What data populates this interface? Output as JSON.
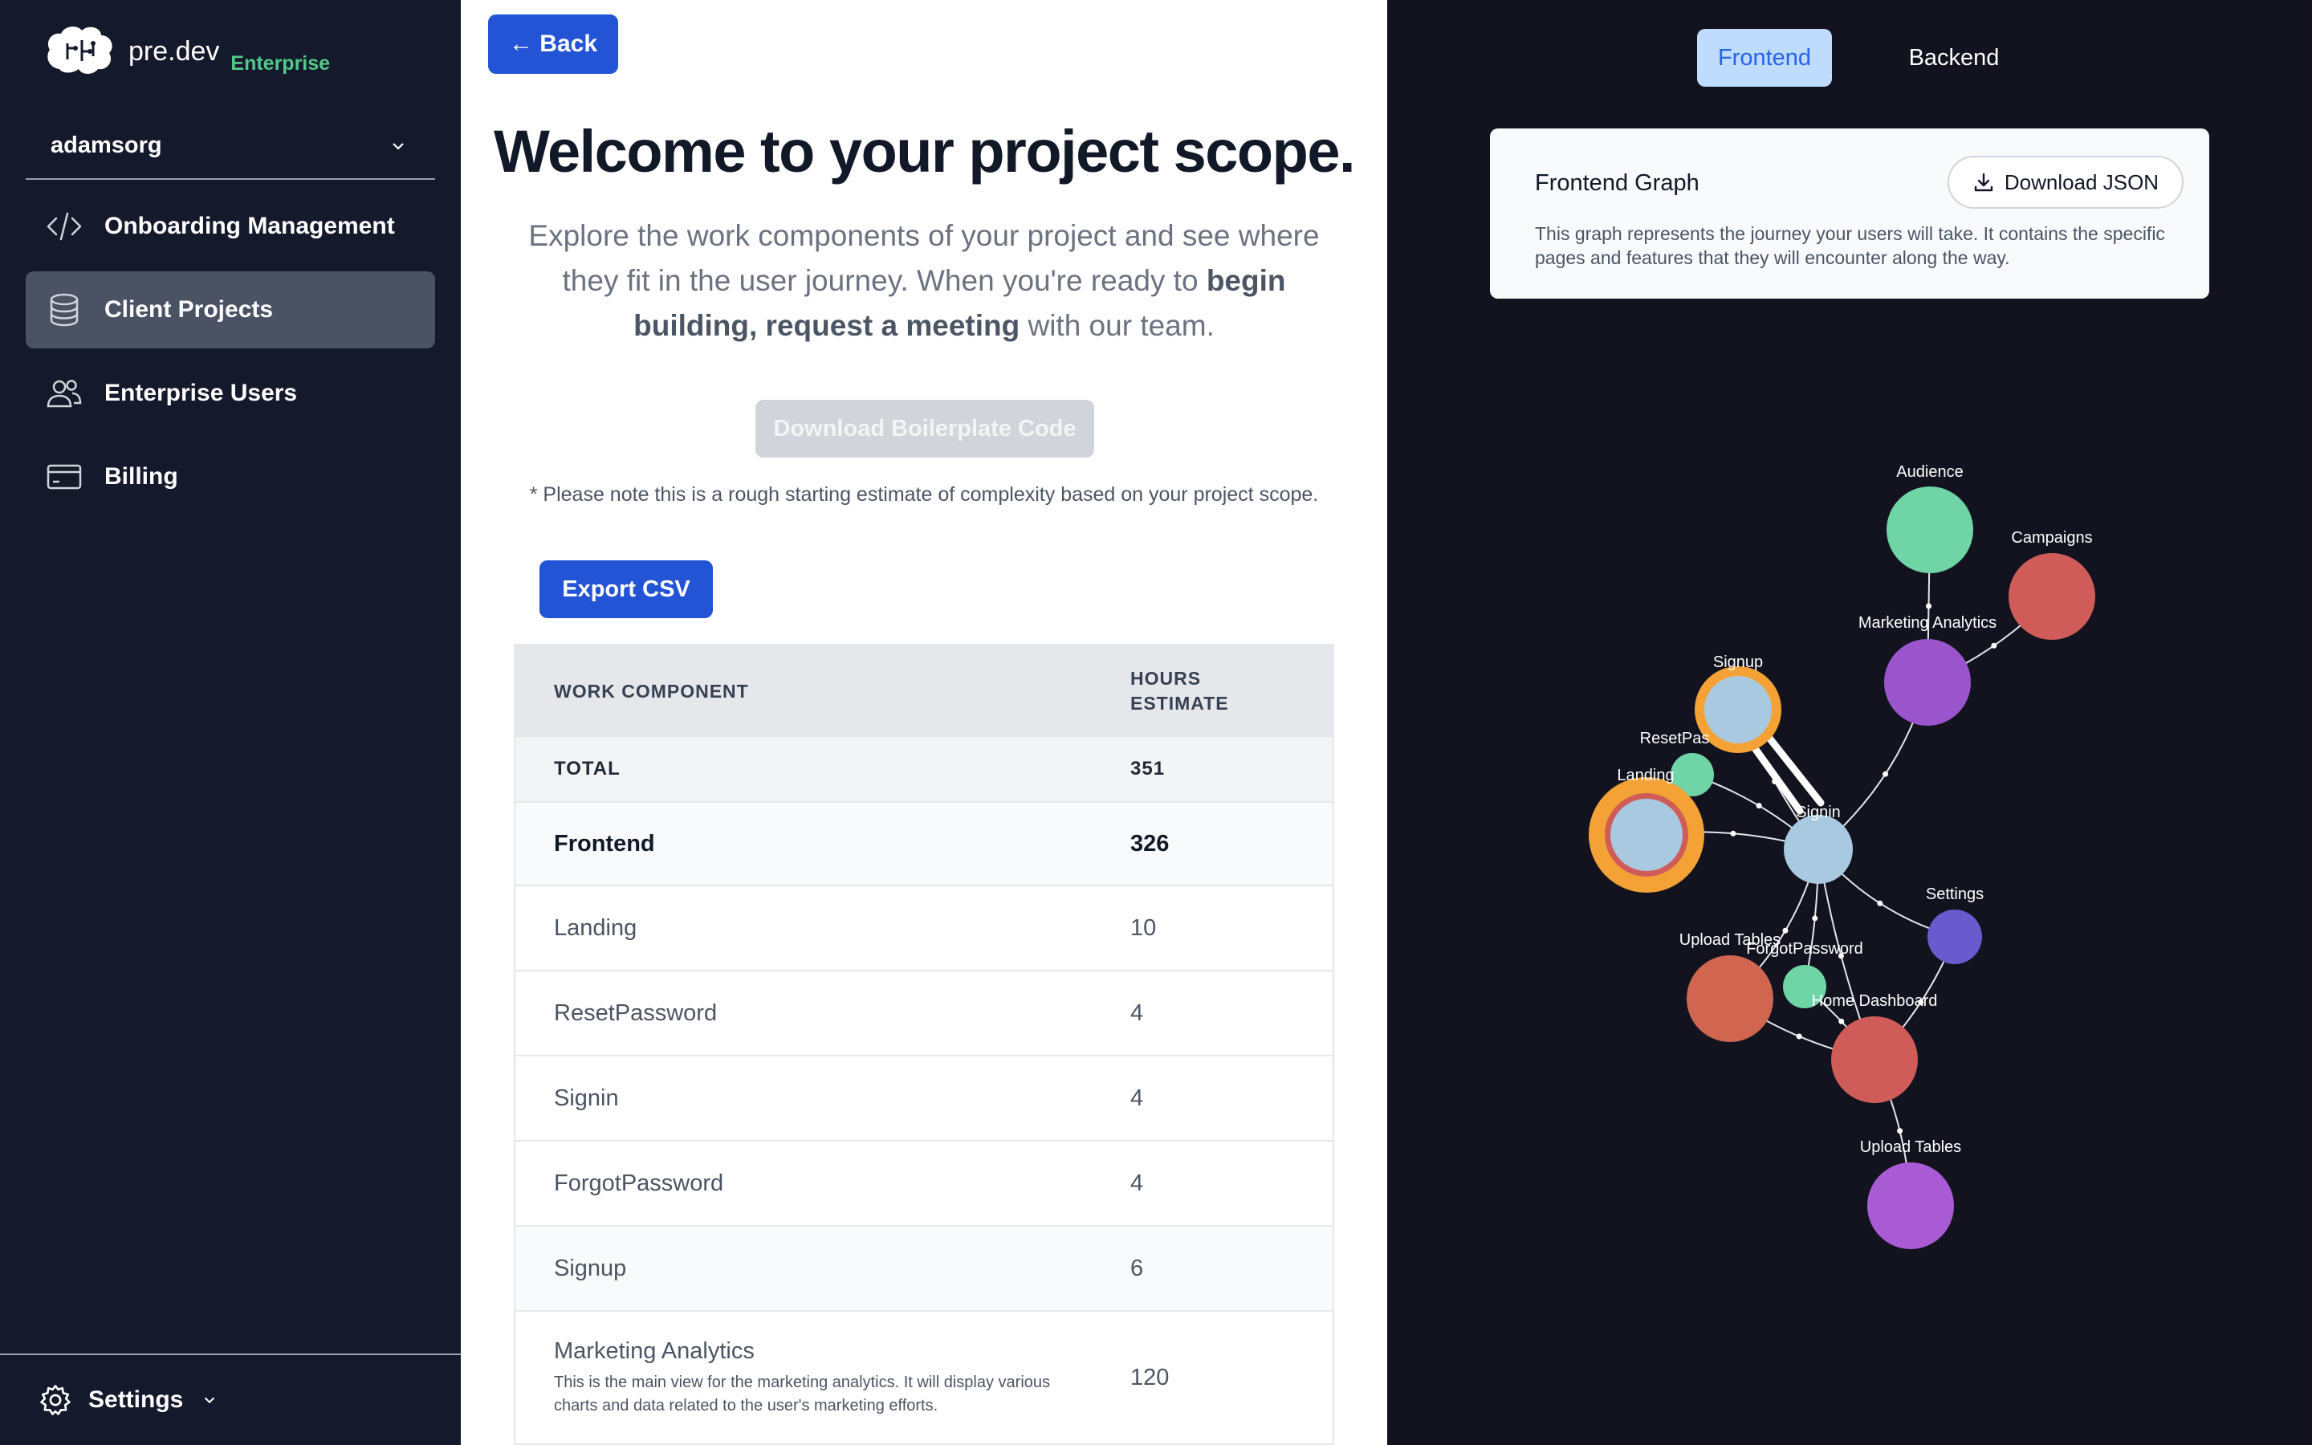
{
  "sidebar": {
    "brand": "pre.dev",
    "badge": "Enterprise",
    "org": "adamsorg",
    "items": [
      {
        "label": "Onboarding Management",
        "icon": "code-icon"
      },
      {
        "label": "Client Projects",
        "icon": "database-icon"
      },
      {
        "label": "Enterprise Users",
        "icon": "users-icon"
      },
      {
        "label": "Billing",
        "icon": "credit-card-icon"
      }
    ],
    "settings": "Settings"
  },
  "main": {
    "back": "← Back",
    "title": "Welcome to your project scope.",
    "subtitle_1": "Explore the work components of your project and see where they fit in the user journey. When you're ready to ",
    "subtitle_b1": "begin building",
    "subtitle_2": ", ",
    "subtitle_b2": "request a meeting",
    "subtitle_3": " with our team.",
    "boilerplate": "Download Boilerplate Code",
    "note": "* Please note this is a rough starting estimate of complexity based on your project scope.",
    "export": "Export CSV",
    "table": {
      "col1": "WORK COMPONENT",
      "col2_line1": "HOURS",
      "col2_line2": "ESTIMATE",
      "total_label": "TOTAL",
      "total_value": "351",
      "group_label": "Frontend",
      "group_value": "326",
      "rows": [
        {
          "name": "Landing",
          "hours": "10"
        },
        {
          "name": "ResetPassword",
          "hours": "4"
        },
        {
          "name": "Signin",
          "hours": "4"
        },
        {
          "name": "ForgotPassword",
          "hours": "4"
        },
        {
          "name": "Signup",
          "hours": "6"
        },
        {
          "name": "Marketing Analytics",
          "hours": "120",
          "desc": "This is the main view for the marketing analytics. It will display various charts and data related to the user's marketing efforts."
        }
      ]
    }
  },
  "right": {
    "tabs": [
      "Frontend",
      "Backend"
    ],
    "card_title": "Frontend Graph",
    "download_json": "Download JSON",
    "card_desc": "This graph represents the journey your users will take. It contains the specific pages and features that they will encounter along the way.",
    "graph": {
      "nodes": [
        {
          "id": "audience",
          "label": "Audience",
          "color": "#6fd4a6"
        },
        {
          "id": "campaigns",
          "label": "Campaigns",
          "color": "#d05c5a"
        },
        {
          "id": "marketing",
          "label": "Marketing Analytics",
          "color": "#9b55cc"
        },
        {
          "id": "signup",
          "label": "Signup",
          "color": "#a9c9e0",
          "ring": "#f4a235"
        },
        {
          "id": "resetpass",
          "label": "ResetPas",
          "color": "#6fd4a6"
        },
        {
          "id": "landing",
          "label": "Landing",
          "color": "#a9c9e0",
          "ring": "#f4a235",
          "inner_ring": "#d05c5a"
        },
        {
          "id": "signin",
          "label": "Signin",
          "color": "#a9c9e0"
        },
        {
          "id": "settings",
          "label": "Settings",
          "color": "#6a5acd"
        },
        {
          "id": "upload1",
          "label": "Upload Tables",
          "color": "#d06650"
        },
        {
          "id": "forgot",
          "label": "ForgotPassword",
          "color": "#6fd4a6"
        },
        {
          "id": "home",
          "label": "Home Dashboard",
          "color": "#d05c5a"
        },
        {
          "id": "upload2",
          "label": "Upload Tables",
          "color": "#a95bd3"
        }
      ]
    }
  }
}
